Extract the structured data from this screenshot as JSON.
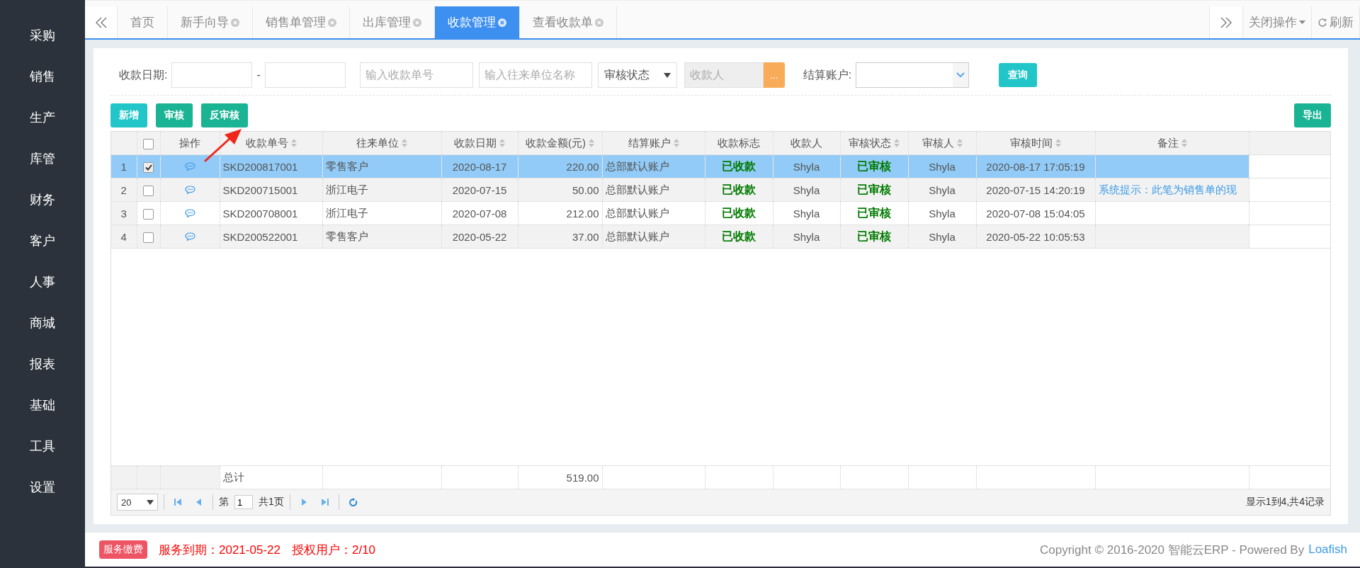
{
  "sidebar": {
    "items": [
      {
        "label": "采购"
      },
      {
        "label": "销售"
      },
      {
        "label": "生产"
      },
      {
        "label": "库管"
      },
      {
        "label": "财务"
      },
      {
        "label": "客户"
      },
      {
        "label": "人事"
      },
      {
        "label": "商城"
      },
      {
        "label": "报表"
      },
      {
        "label": "基础"
      },
      {
        "label": "工具"
      },
      {
        "label": "设置"
      }
    ]
  },
  "tabs": [
    {
      "label": "首页",
      "selected": false,
      "closable": false
    },
    {
      "label": "新手向导",
      "selected": false,
      "closable": true
    },
    {
      "label": "销售单管理",
      "selected": false,
      "closable": true
    },
    {
      "label": "出库管理",
      "selected": false,
      "closable": true
    },
    {
      "label": "收款管理",
      "selected": true,
      "closable": true
    },
    {
      "label": "查看收款单",
      "selected": false,
      "closable": true
    }
  ],
  "tab_actions": {
    "close_menu": "关闭操作",
    "refresh": "刷新"
  },
  "filters": {
    "date_label": "收款日期:",
    "date_separator": "-",
    "order_no_placeholder": "输入收款单号",
    "partner_placeholder": "输入往来单位名称",
    "audit_status": "审核状态",
    "payee_placeholder": "收款人",
    "payee_button": "...",
    "account_label": "结算账户:",
    "query_button": "查询"
  },
  "toolbar": [
    {
      "label": "新增",
      "kind": "info"
    },
    {
      "label": "审核",
      "kind": "primary"
    },
    {
      "label": "反审核",
      "kind": "primary"
    }
  ],
  "export_button": "导出",
  "table": {
    "header_checked": false,
    "action_column": "操作",
    "columns": [
      {
        "label": "收款单号",
        "sortable": true
      },
      {
        "label": "往来单位",
        "sortable": true
      },
      {
        "label": "收款日期",
        "sortable": true
      },
      {
        "label": "收款金额(元)",
        "sortable": true
      },
      {
        "label": "结算账户",
        "sortable": true
      },
      {
        "label": "收款标志",
        "sortable": false
      },
      {
        "label": "收款人",
        "sortable": false
      },
      {
        "label": "审核状态",
        "sortable": true
      },
      {
        "label": "审核人",
        "sortable": true
      },
      {
        "label": "审核时间",
        "sortable": true
      },
      {
        "label": "备注",
        "sortable": true
      }
    ],
    "rows": [
      {
        "no": "1",
        "selected": true,
        "cells": [
          "SKD200817001",
          "零售客户",
          "2020-08-17",
          "220.00",
          "总部默认账户",
          "已收款",
          "Shyla",
          "已审核",
          "Shyla",
          "2020-08-17 17:05:19",
          null
        ]
      },
      {
        "no": "2",
        "selected": false,
        "cells": [
          "SKD200715001",
          "浙江电子",
          "2020-07-15",
          "50.00",
          "总部默认账户",
          "已收款",
          "Shyla",
          "已审核",
          "Shyla",
          "2020-07-15 14:20:19",
          "系统提示：此笔为销售单的现"
        ]
      },
      {
        "no": "3",
        "selected": false,
        "cells": [
          "SKD200708001",
          "浙江电子",
          "2020-07-08",
          "212.00",
          "总部默认账户",
          "已收款",
          "Shyla",
          "已审核",
          "Shyla",
          "2020-07-08 15:04:05",
          null
        ]
      },
      {
        "no": "4",
        "selected": false,
        "cells": [
          "SKD200522001",
          "零售客户",
          "2020-05-22",
          "37.00",
          "总部默认账户",
          "已收款",
          "Shyla",
          "已审核",
          "Shyla",
          "2020-05-22 10:05:53",
          null
        ]
      }
    ],
    "total_label": "总计",
    "total_amount": "519.00"
  },
  "pager": {
    "page_size": "20",
    "page_prefix": "第",
    "page": "1",
    "page_suffix": "共1页",
    "summary": "显示1到4,共4记录"
  },
  "footer": {
    "badge": "服务缴费",
    "expiry": "服务到期：2021-05-22",
    "users": "授权用户：2/10",
    "copyright": "Copyright © 2016-2020 智能云ERP - Powered By",
    "link": "Loafish"
  }
}
